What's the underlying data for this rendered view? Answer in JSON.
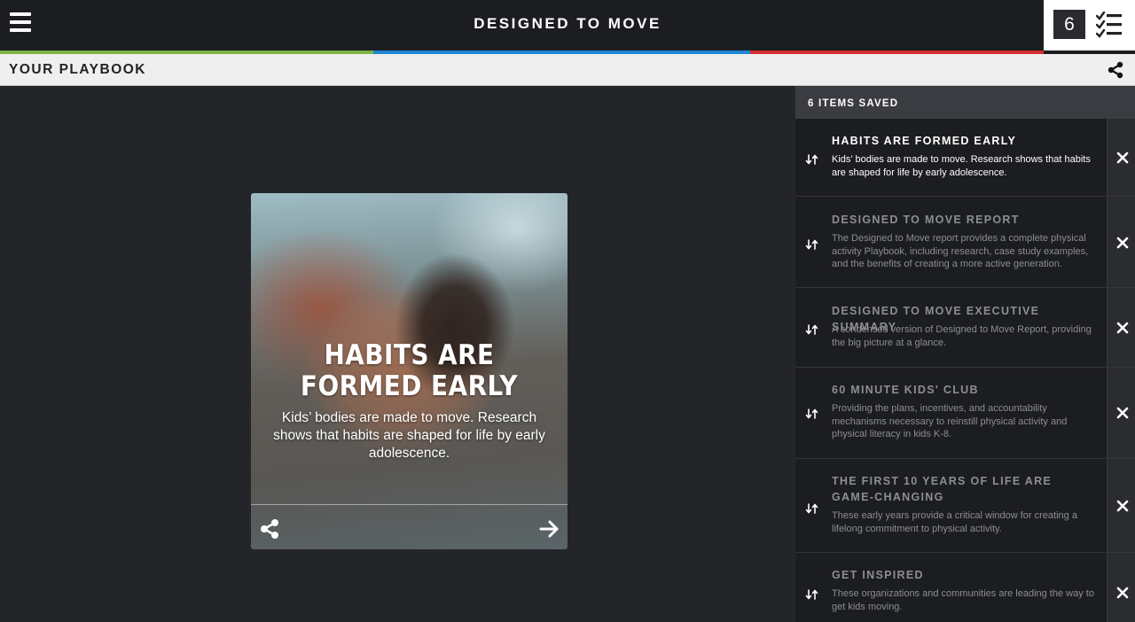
{
  "header": {
    "menu_icon": "hamburger-menu-icon",
    "title": "DESIGNED TO MOVE",
    "saved_count": "6",
    "checklist_icon": "checklist-icon"
  },
  "stripe_colors": [
    "#7cb342",
    "#1e88d6",
    "#d32f2f",
    "#1c1d20"
  ],
  "playbook": {
    "title": "YOUR PLAYBOOK",
    "share_icon": "share-icon"
  },
  "card": {
    "title": "HABITS ARE FORMED EARLY",
    "description": "Kids’ bodies are made to move. Research shows that habits are shaped for life by early adolescence.",
    "share_icon": "share-icon",
    "next_icon": "arrow-right-icon"
  },
  "sidebar": {
    "header": "6 ITEMS SAVED",
    "items": [
      {
        "title": "HABITS ARE FORMED EARLY",
        "description": "Kids’ bodies are made to move. Research shows that habits are shaped for life by early adolescence.",
        "active": true
      },
      {
        "title": "DESIGNED TO MOVE REPORT",
        "description": "The Designed to Move report provides a complete physical activity Playbook, including research, case study examples, and the benefits of creating a more active generation.",
        "active": false
      },
      {
        "title": "DESIGNED TO MOVE EXECUTIVE SUMMARY",
        "description": "A condensed version of Designed to Move Report, providing the big picture at a glance.",
        "active": false
      },
      {
        "title": "60 MINUTE KIDS' CLUB",
        "description": "Providing the plans, incentives, and accountability mechanisms necessary to reinstill physical activity and physical literacy in kids K-8.",
        "active": false
      },
      {
        "title": "THE FIRST 10 YEARS OF LIFE ARE GAME-CHANGING",
        "description": "These early years provide a critical window for creating a lifelong commitment to physical activity.",
        "active": false
      },
      {
        "title": "GET INSPIRED",
        "description": "These organizations and communities are leading the way to get kids moving.",
        "active": false
      }
    ],
    "reorder_icon": "reorder-arrows-icon",
    "remove_icon": "close-icon"
  }
}
